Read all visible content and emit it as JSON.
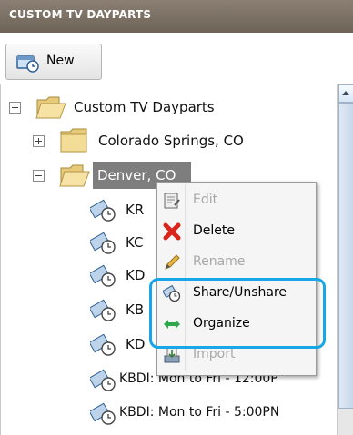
{
  "panel": {
    "title": "CUSTOM TV DAYPARTS"
  },
  "toolbar": {
    "new_label": "New"
  },
  "tree": {
    "root_label": "Custom TV Dayparts",
    "folders": [
      {
        "label": "Colorado Springs, CO",
        "expanded": false
      },
      {
        "label": "Denver, CO",
        "expanded": true,
        "selected": true
      }
    ],
    "items": [
      "KR",
      "KC",
      "KD",
      "KB",
      "KD",
      "KBDI: Mon to Fri - 12:00P",
      "KBDI: Mon to Fri - 5:00PN"
    ]
  },
  "context_menu": {
    "items": [
      {
        "label": "Edit",
        "enabled": false,
        "icon": "edit-icon"
      },
      {
        "label": "Delete",
        "enabled": true,
        "icon": "delete-x-icon"
      },
      {
        "label": "Rename",
        "enabled": false,
        "icon": "pencil-icon"
      },
      {
        "label": "Share/Unshare",
        "enabled": true,
        "icon": "share-icon"
      },
      {
        "label": "Organize",
        "enabled": true,
        "icon": "organize-arrows-icon"
      },
      {
        "label": "Import",
        "enabled": false,
        "icon": "import-icon"
      }
    ],
    "highlight_color": "#18a7e6"
  },
  "colors": {
    "titlebar": "#7a6f63",
    "selection": "#7e7e7e",
    "delete": "#d9261c",
    "organize": "#2ea84a"
  }
}
